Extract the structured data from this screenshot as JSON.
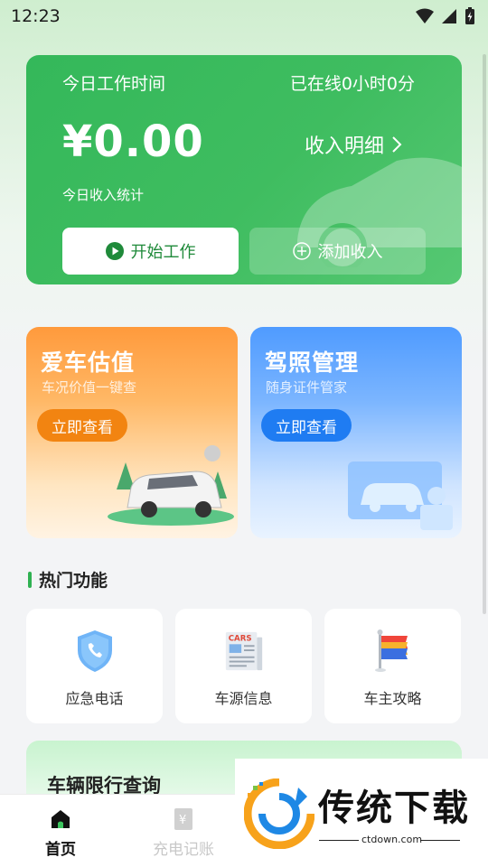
{
  "status_bar": {
    "time": "12:23"
  },
  "hero": {
    "work_time_label": "今日工作时间",
    "online_text": "已在线0小时0分",
    "amount": "¥0.00",
    "detail_link": "收入明细",
    "stat_label": "今日收入统计",
    "start_button": "开始工作",
    "add_button": "添加收入"
  },
  "promos": [
    {
      "title": "爱车估值",
      "subtitle": "车况价值一键查",
      "button": "立即查看"
    },
    {
      "title": "驾照管理",
      "subtitle": "随身证件管家",
      "button": "立即查看"
    }
  ],
  "hot_section": {
    "title": "热门功能",
    "items": [
      {
        "label": "应急电话",
        "icon": "shield-phone-icon"
      },
      {
        "label": "车源信息",
        "icon": "cars-newspaper-icon"
      },
      {
        "label": "车主攻略",
        "icon": "flag-icon"
      }
    ]
  },
  "restriction": {
    "title": "车辆限行查询"
  },
  "bottom_nav": [
    {
      "label": "首页",
      "icon": "home-icon",
      "active": true
    },
    {
      "label": "充电记账",
      "icon": "ledger-icon",
      "active": false
    }
  ],
  "watermark": {
    "brand": "传统下载",
    "url": "ctdown.com"
  },
  "colors": {
    "primary_green": "#34b85a",
    "orange": "#ff9a3c",
    "blue": "#4f9bff"
  }
}
